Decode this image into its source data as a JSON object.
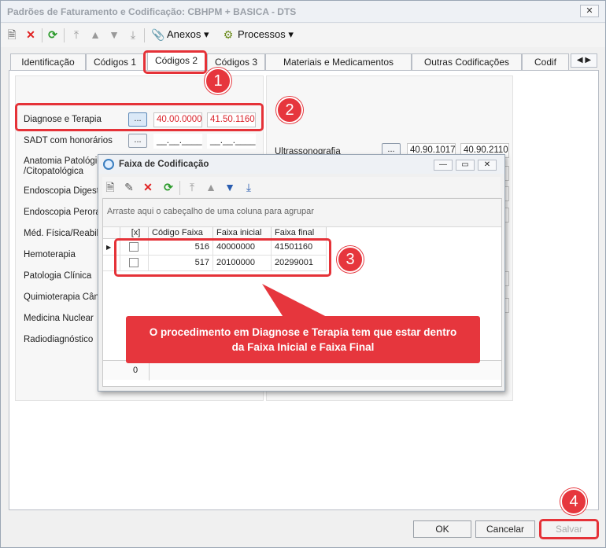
{
  "window": {
    "title": "Padrões de Faturamento e Codificação: CBHPM + BASICA - DTS",
    "close": "✕"
  },
  "toolbar": {
    "anexos": "Anexos",
    "processos": "Processos"
  },
  "tabs": [
    {
      "label": "Identificação"
    },
    {
      "label": "Códigos 1"
    },
    {
      "label": "Códigos 2"
    },
    {
      "label": "Códigos 3"
    },
    {
      "label": "Materiais e Medicamentos"
    },
    {
      "label": "Outras Codificações"
    },
    {
      "label": "Codif"
    }
  ],
  "left_rows": [
    {
      "label": "Diagnose e Terapia",
      "dots": "...",
      "from": "40.00.0000",
      "to": "41.50.1160"
    },
    {
      "label": "SADT com honorários",
      "dots": "...",
      "from": "__.__.____",
      "to": "__.__.____"
    },
    {
      "label": "Anatomia Patológic /Citopatológica"
    },
    {
      "label": "Endoscopia Digest"
    },
    {
      "label": "Endoscopia Perora"
    },
    {
      "label": "Méd. Física/Reabil"
    },
    {
      "label": "Hemoterapia"
    },
    {
      "label": "Patologia Clínica"
    },
    {
      "label": "Quimioterapia Cân"
    },
    {
      "label": "Medicina Nuclear"
    },
    {
      "label": "Radiodiagnóstico"
    }
  ],
  "right_rows": [
    {
      "label": "Ultrassonografia",
      "dots": "...",
      "from": "40.90.1017",
      "to": "40.90.2110"
    }
  ],
  "dialog": {
    "title": "Faixa de Codificação",
    "groupby_hint": "Arraste aqui o cabeçalho de uma coluna para agrupar",
    "columns": [
      "[x]",
      "Código Faixa",
      "Faixa inicial",
      "Faixa final"
    ],
    "rows": [
      {
        "codigo": "516",
        "inicial": "40000000",
        "final": "41501160"
      },
      {
        "codigo": "517",
        "inicial": "20100000",
        "final": "20299001"
      }
    ],
    "footer_count": "0"
  },
  "callout": {
    "line1": "O procedimento em Diagnose e Terapia tem que estar dentro",
    "line2": "da Faixa Inicial e Faixa Final"
  },
  "badges": [
    "1",
    "2",
    "3",
    "4"
  ],
  "buttons": {
    "ok": "OK",
    "cancel": "Cancelar",
    "save": "Salvar"
  },
  "colors": {
    "highlight": "#e53238",
    "callout": "#e6363d",
    "field_red": "#d9232b"
  }
}
